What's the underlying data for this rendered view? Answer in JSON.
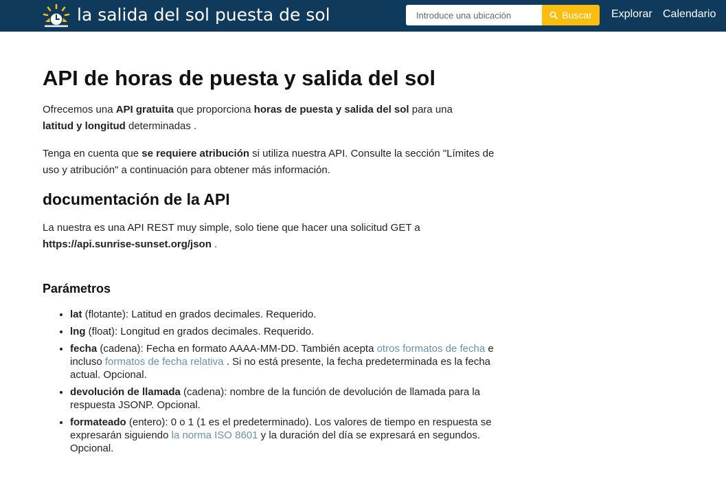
{
  "header": {
    "brand": "la salida del sol puesta de sol",
    "search_placeholder": "Introduce una ubicación",
    "search_button": "Buscar",
    "nav": [
      "Explorar",
      "Calendario"
    ],
    "colors": {
      "bar": "#0f3a5c",
      "button": "#fbbd0f",
      "link": "#6b8fa8"
    }
  },
  "main": {
    "title": "API de horas de puesta y salida del sol",
    "intro": {
      "t1": "Ofrecemos una ",
      "b1": "API gratuita",
      "t2": " que proporciona ",
      "b2": "horas de puesta y salida del sol",
      "t3": " para una ",
      "b3": "latitud y longitud",
      "t4": " determinadas ."
    },
    "notice": {
      "t1": "Tenga en cuenta que ",
      "b1": "se requiere atribución",
      "t2": " si utiliza nuestra API. Consulte la sección \"Límites de uso y atribución\" a continuación para obtener más información."
    },
    "doc_heading": "documentación de la API",
    "doc_text": {
      "t1": "La nuestra es una API REST muy simple, solo tiene que hacer una solicitud GET a ",
      "url": "https://api.sunrise-sunset.org/json",
      "t2": " ."
    },
    "params_heading": "Parámetros",
    "params": [
      {
        "name": "lat",
        "desc": " (flotante): Latitud en grados decimales. Requerido."
      },
      {
        "name": "lng",
        "desc": " (float): Longitud en grados decimales. Requerido."
      },
      {
        "name": "fecha",
        "t1": " (cadena): Fecha en formato AAAA-MM-DD. También acepta ",
        "link1": "otros formatos de fecha",
        "t2": " e incluso ",
        "link2": "formatos de fecha relativa",
        "t3": " . Si no está presente, la fecha predeterminada es la fecha actual. Opcional."
      },
      {
        "name": "devolución de llamada",
        "desc": " (cadena): nombre de la función de devolución de llamada para la respuesta JSONP. Opcional."
      },
      {
        "name": "formateado",
        "t1": " (entero): 0 o 1 (1 es el predeterminado). Los valores de tiempo en respuesta se expresarán siguiendo ",
        "link1": "la norma ISO 8601",
        "t2": " y la duración del día se expresará en segundos. Opcional."
      }
    ]
  }
}
